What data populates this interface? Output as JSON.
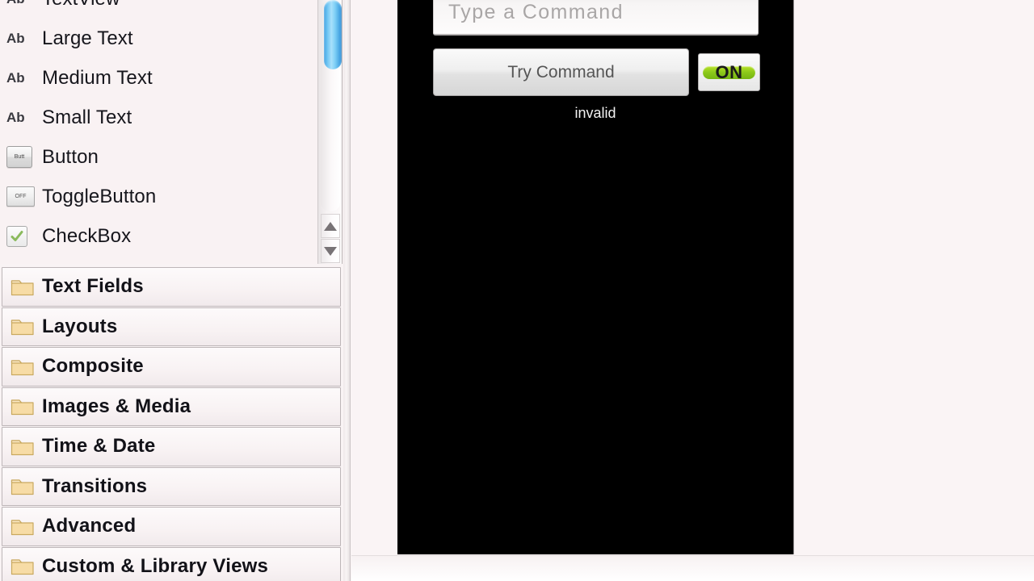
{
  "palette": {
    "widgets": [
      {
        "icon": "text-ab-icon",
        "icon_glyph": "Ab",
        "label": "TextView"
      },
      {
        "icon": "text-ab-icon",
        "icon_glyph": "Ab",
        "label": "Large Text"
      },
      {
        "icon": "text-ab-icon",
        "icon_glyph": "Ab",
        "label": "Medium Text"
      },
      {
        "icon": "text-ab-icon",
        "icon_glyph": "Ab",
        "label": "Small Text"
      },
      {
        "icon": "button-widget-icon",
        "icon_glyph": "Butt",
        "label": "Button"
      },
      {
        "icon": "toggle-button-widget-icon",
        "icon_glyph": "OFF",
        "label": "ToggleButton"
      },
      {
        "icon": "checkbox-widget-icon",
        "icon_glyph": "check",
        "label": "CheckBox"
      }
    ],
    "categories": [
      {
        "icon": "folder-icon",
        "label": "Text Fields"
      },
      {
        "icon": "folder-icon",
        "label": "Layouts"
      },
      {
        "icon": "folder-icon",
        "label": "Composite"
      },
      {
        "icon": "folder-icon",
        "label": "Images & Media"
      },
      {
        "icon": "folder-icon",
        "label": "Time & Date"
      },
      {
        "icon": "folder-icon",
        "label": "Transitions"
      },
      {
        "icon": "folder-icon",
        "label": "Advanced"
      },
      {
        "icon": "folder-icon",
        "label": "Custom & Library Views"
      }
    ],
    "scrollbar": {
      "up_arrow_icon": "triangle-up-icon",
      "down_arrow_icon": "triangle-down-icon"
    }
  },
  "preview": {
    "command_input": {
      "value": "",
      "placeholder": "Type a Command"
    },
    "try_command_label": "Try Command",
    "toggle": {
      "label": "ON",
      "state": "on",
      "on_color": "#8cc81a"
    },
    "status_text": "invalid",
    "background_color": "#000000"
  },
  "colors": {
    "app_background": "#faf4f5",
    "panel_background": "#f9f2f3",
    "scroll_thumb": "#4aa8e4",
    "folder_icon": "#f5d79a"
  }
}
